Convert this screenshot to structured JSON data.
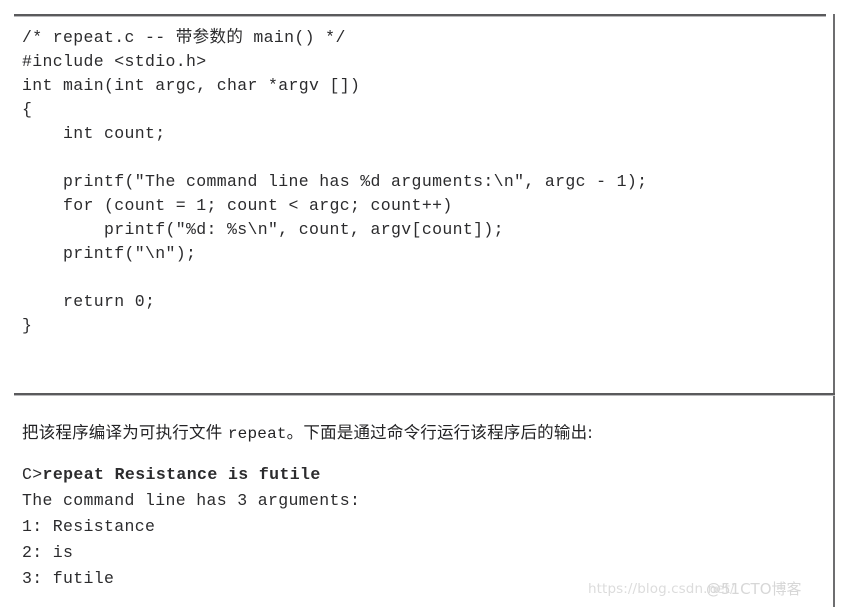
{
  "document": {
    "page_background": "#ffffff",
    "text_color": "#2b2b2d",
    "rule_color": "#5a5a5c"
  },
  "code_listing": {
    "language": "c",
    "filename": "repeat.c",
    "lines": [
      "/* repeat.c -- 带参数的 main() */",
      "#include <stdio.h>",
      "int main(int argc, char *argv [])",
      "{",
      "    int count;",
      "",
      "    printf(\"The command line has %d arguments:\\n\", argc - 1);",
      "    for (count = 1; count < argc; count++)",
      "        printf(\"%d: %s\\n\", count, argv[count]);",
      "    printf(\"\\n\");",
      "",
      "    return 0;",
      "}"
    ]
  },
  "prose": {
    "before_mono": "把该程序编译为可执行文件 ",
    "mono": "repeat",
    "after_mono": "。下面是通过命令行运行该程序后的输出:"
  },
  "terminal": {
    "prompt": "C>",
    "command": "repeat Resistance is futile",
    "output_lines": [
      "The command line has 3 arguments:",
      "1: Resistance",
      "2: is",
      "3: futile"
    ]
  },
  "watermark": {
    "url": "https://blog.csdn.net/",
    "tag": "@51CTO博客"
  }
}
